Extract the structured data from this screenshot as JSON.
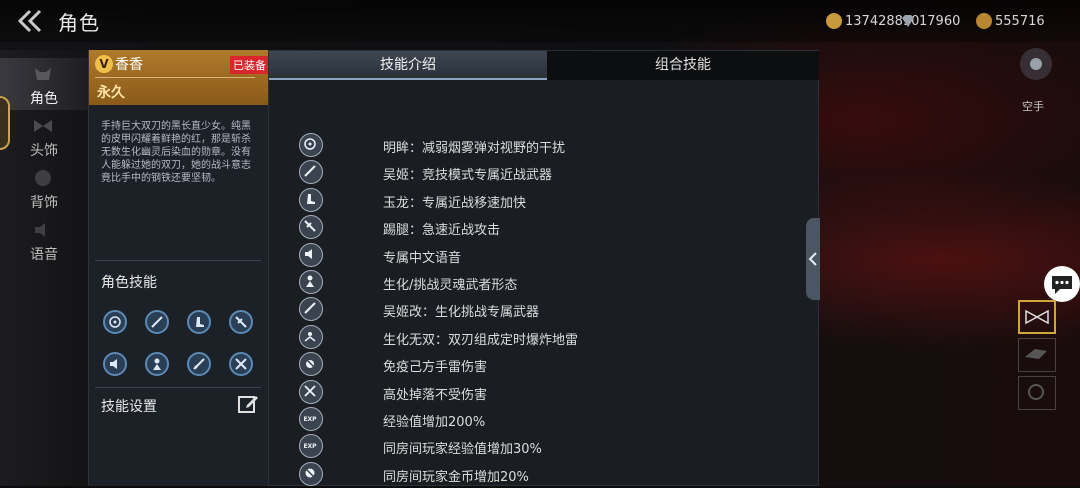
{
  "topbar": {
    "title": "角色",
    "currencies": [
      {
        "icon": "gold-coin-icon",
        "value": "137428890"
      },
      {
        "icon": "diamond-icon",
        "value": "17960"
      },
      {
        "icon": "point-coin-icon",
        "value": "555716"
      }
    ]
  },
  "leftnav": {
    "items": [
      {
        "label": "角色"
      },
      {
        "label": "头饰"
      },
      {
        "label": "背饰"
      },
      {
        "label": "语音"
      }
    ]
  },
  "character": {
    "vip": "V",
    "name": "香香",
    "equipped": "已装备",
    "duration": "永久",
    "description": "手持巨大双刀的黑长直少女。纯黑的皮甲闪耀着鲜艳的红，那是斩杀无数生化幽灵后染血的勋章。没有人能躲过她的双刀，她的战斗意志竟比手中的钢铁还要坚韧。",
    "skills_title": "角色技能",
    "skill_settings": "技能设置"
  },
  "tabs": [
    {
      "label": "技能介绍"
    },
    {
      "label": "组合技能"
    }
  ],
  "skills": [
    {
      "icon": "crosshair-icon",
      "text": "明眸：减弱烟雾弹对视野的干扰"
    },
    {
      "icon": "blade-icon",
      "text": "吴姬：竞技模式专属近战武器"
    },
    {
      "icon": "boot-icon",
      "text": "玉龙：专属近战移速加快"
    },
    {
      "icon": "kick-icon",
      "text": "踢腿：急速近战攻击"
    },
    {
      "icon": "voice-icon",
      "text": "专属中文语音"
    },
    {
      "icon": "soul-warrior-icon",
      "text": "生化/挑战灵魂武者形态"
    },
    {
      "icon": "blade-icon",
      "text": "吴姬改：生化挑战专属武器"
    },
    {
      "icon": "dual-blade-mine-icon",
      "text": "生化无双：双刃组成定时爆炸地雷"
    },
    {
      "icon": "grenade-immune-icon",
      "text": "免疫己方手雷伤害"
    },
    {
      "icon": "fall-immune-icon",
      "text": "高处掉落不受伤害"
    },
    {
      "icon": "exp-icon",
      "text": "经验值增加200%"
    },
    {
      "icon": "room-exp-icon",
      "text": "同房间玩家经验值增加30%"
    },
    {
      "icon": "room-gold-icon",
      "text": "同房间玩家金币增加20%"
    }
  ],
  "right": {
    "unarmed_label": "空手"
  },
  "colors": {
    "accent_gold": "#b07a2b",
    "equipped_red": "#d8262c",
    "panel_bg": "#1a1d22"
  }
}
